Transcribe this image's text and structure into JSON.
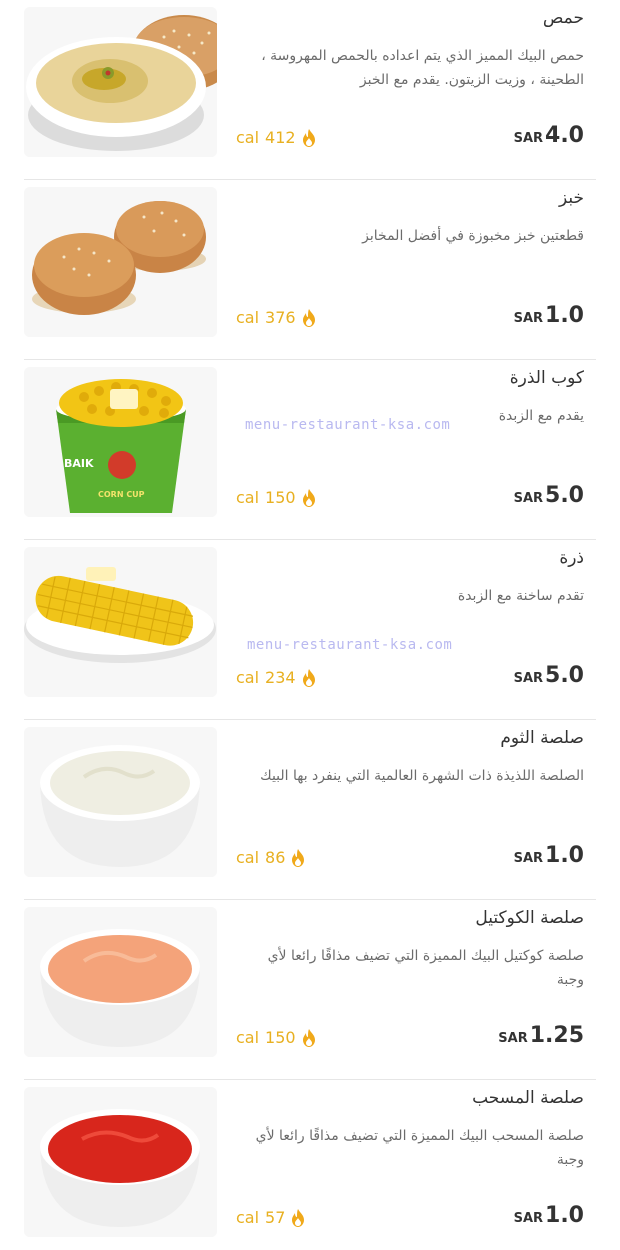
{
  "watermark": "menu-restaurant-ksa.com",
  "colors": {
    "calorie": "#e8b021",
    "text": "#333333",
    "muted": "#6b6b6b",
    "divider": "#e6e6e6"
  },
  "items": [
    {
      "title": "حمص",
      "desc": "حمص البيك المميز الذي يتم اعداده بالحمص المهروسة ، الطحينة ، وزيت الزيتون. يقدم مع الخبز",
      "cal_value": "412",
      "cal_unit": "cal",
      "currency": "SAR",
      "price": "4.0",
      "image_icon": "hummus-image"
    },
    {
      "title": "خبز",
      "desc": "قطعتين خبز مخبوزة في أفضل المخابز",
      "cal_value": "376",
      "cal_unit": "cal",
      "currency": "SAR",
      "price": "1.0",
      "image_icon": "bread-image"
    },
    {
      "title": "كوب الذرة",
      "desc": "يقدم مع الزبدة",
      "cal_value": "150",
      "cal_unit": "cal",
      "currency": "SAR",
      "price": "5.0",
      "image_icon": "corn-cup-image",
      "cup_brand": "BAIK",
      "cup_text": "CORN CUP"
    },
    {
      "title": "ذرة",
      "desc": "تقدم ساخنة مع الزبدة",
      "cal_value": "234",
      "cal_unit": "cal",
      "currency": "SAR",
      "price": "5.0",
      "image_icon": "corn-cob-image"
    },
    {
      "title": "صلصة الثوم",
      "desc": "الصلصة اللذيذة ذات الشهرة العالمية التي ينفرد بها البيك",
      "cal_value": "86",
      "cal_unit": "cal",
      "currency": "SAR",
      "price": "1.0",
      "image_icon": "garlic-sauce-image"
    },
    {
      "title": "صلصة الكوكتيل",
      "desc": "صلصة كوكتيل البيك المميزة التي تضيف مذاقًا رائعا لأي وجبة",
      "cal_value": "150",
      "cal_unit": "cal",
      "currency": "SAR",
      "price": "1.25",
      "image_icon": "cocktail-sauce-image"
    },
    {
      "title": "صلصة المسحب",
      "desc": "صلصة المسحب البيك المميزة التي تضيف مذاقًا رائعا لأي وجبة",
      "cal_value": "57",
      "cal_unit": "cal",
      "currency": "SAR",
      "price": "1.0",
      "image_icon": "ketchup-sauce-image"
    }
  ]
}
